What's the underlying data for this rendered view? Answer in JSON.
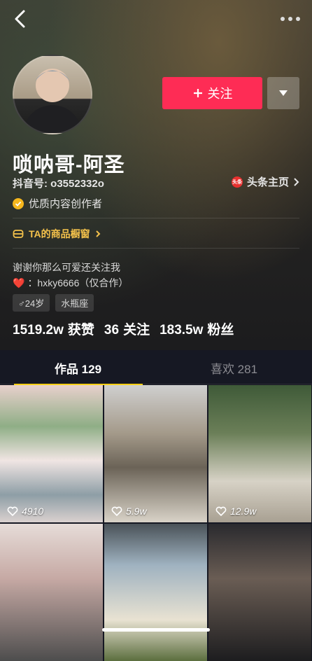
{
  "profile": {
    "name": "唢呐哥-阿圣",
    "handle": "抖音号: o3552332o",
    "toutiao_label": "头条主页",
    "toutiao_logo_text": "头条",
    "verified_label": "优质内容创作者",
    "shop_label": "TA的商品橱窗",
    "bio_line1": "谢谢你那么可爱还关注我",
    "bio_line2_heart": "❤️",
    "bio_line2_text": "：hxky6666（仅合作）",
    "tags": [
      "♂24岁",
      "水瓶座"
    ]
  },
  "actions": {
    "follow_label": "关注"
  },
  "stats": [
    {
      "num": "1519.2w",
      "label": "获赞"
    },
    {
      "num": "36",
      "label": "关注"
    },
    {
      "num": "183.5w",
      "label": "粉丝"
    }
  ],
  "tabs": [
    {
      "label": "作品 129",
      "active": true
    },
    {
      "label": "喜欢 281",
      "active": false
    }
  ],
  "videos": [
    {
      "likes": "4910"
    },
    {
      "likes": "5.9w"
    },
    {
      "likes": "12.9w"
    },
    {
      "likes": ""
    },
    {
      "likes": ""
    },
    {
      "likes": ""
    }
  ],
  "colors": {
    "accent": "#fe2c55",
    "tab_indicator": "#face15",
    "shop_text": "#f3c14b",
    "verified": "#f6b71d",
    "background": "#161823"
  },
  "icons": [
    "back-arrow-icon",
    "more-dots-icon",
    "plus-icon",
    "dropdown-triangle-icon",
    "toutiao-logo-icon",
    "chevron-right-icon",
    "verified-check-icon",
    "shop-bag-icon",
    "heart-icon"
  ]
}
